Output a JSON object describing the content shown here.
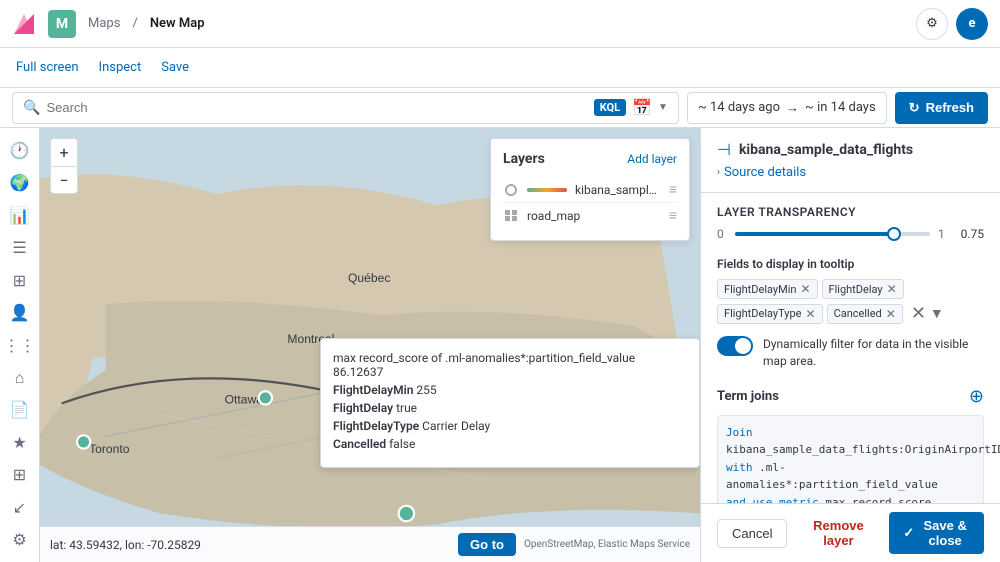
{
  "app": {
    "logo_letter": "K",
    "app_icon_letter": "M",
    "nav_maps": "Maps",
    "nav_new_map": "New Map"
  },
  "topbar": {
    "gear_icon": "⚙",
    "user_letter": "e",
    "fullscreen_label": "Full screen",
    "inspect_label": "Inspect",
    "save_label": "Save"
  },
  "searchbar": {
    "search_placeholder": "Search",
    "kql_label": "KQL",
    "time_ago": "~ 14 days ago",
    "arrow": "→",
    "time_ahead": "~ in 14 days",
    "refresh_label": "Refresh"
  },
  "layers": {
    "title": "Layers",
    "add_layer_label": "Add layer",
    "items": [
      {
        "name": "kibana_sample_data_f...",
        "type": "circle"
      },
      {
        "name": "road_map",
        "type": "grid"
      }
    ]
  },
  "tooltip": {
    "title": "max record_score of .ml-anomalies*:partition_field_value 86.12637",
    "rows": [
      {
        "key": "FlightDelayMin",
        "value": "255"
      },
      {
        "key": "FlightDelay",
        "value": "true"
      },
      {
        "key": "FlightDelayType",
        "value": "Carrier Delay"
      },
      {
        "key": "Cancelled",
        "value": "false"
      }
    ]
  },
  "coordinates": {
    "lat": "lat: 43.59432, lon: -70.25829",
    "goto_label": "Go to",
    "osm_credit": "OpenStreetMap, Elastic Maps Service"
  },
  "right_panel": {
    "layer_icon": "⊣",
    "layer_name": "kibana_sample_data_flights",
    "source_details": "Source details",
    "transparency_label": "Layer transparency",
    "transparency_min": "0",
    "transparency_max": "1",
    "transparency_value": "0.75",
    "tooltip_fields_label": "Fields to display in tooltip",
    "fields": [
      "FlightDelayMin",
      "FlightDelay",
      "FlightDelayType",
      "Cancelled"
    ],
    "dynamic_filter_label": "Dynamically filter for data in the visible map area.",
    "term_joins_title": "Term joins",
    "join_code_line1": "Join",
    "join_code_line2": "kibana_sample_data_flights:OriginAirportID",
    "join_code_line3": "with .ml-anomalies*:partition_field_value",
    "join_code_line4": "and use metric max record_score"
  },
  "bottom_bar": {
    "cancel_label": "Cancel",
    "remove_label": "Remove layer",
    "save_close_label": "Save & close"
  }
}
